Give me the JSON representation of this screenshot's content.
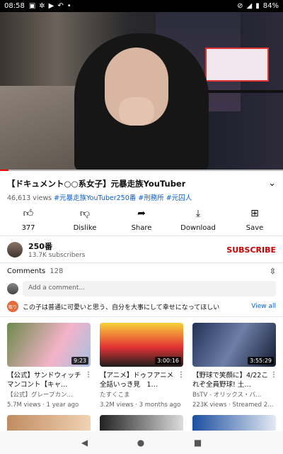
{
  "status_bar": {
    "time": "08:58",
    "battery": "84%"
  },
  "video": {
    "progress_fraction": 0.03
  },
  "title": "【ドキュメント○○系女子】元暴走族YouTuber",
  "meta": {
    "views": "46,613 views",
    "tags": [
      "#元暴走族YouTuber250番",
      "#刑務所",
      "#元囚人"
    ]
  },
  "actions": [
    {
      "icon": "thumbs-up-icon",
      "label": "377"
    },
    {
      "icon": "thumbs-down-icon",
      "label": "Dislike"
    },
    {
      "icon": "share-icon",
      "label": "Share"
    },
    {
      "icon": "download-icon",
      "label": "Download"
    },
    {
      "icon": "save-icon",
      "label": "Save"
    }
  ],
  "channel": {
    "name": "250番",
    "subscribers": "13.7K subscribers",
    "subscribe_label": "SUBSCRIBE"
  },
  "comments": {
    "header": "Comments",
    "count": "128",
    "placeholder": "Add a comment...",
    "top_avatar_text": "取り",
    "top_comment": "この子は普通に可愛いと思う、自分を大事にして幸せになってほしい",
    "view_all": "View all"
  },
  "recommendations": [
    {
      "title": "【公式】サンドウィッチマンコント【キャ…",
      "channel": "【公式】グレープカン…",
      "meta": "5.7M views · 1 year ago",
      "duration": "9:23"
    },
    {
      "title": "【アニメ】ドゥフアニメ全話いっき見　1…",
      "channel": "たすくこま",
      "meta": "3.2M views · 3 months ago",
      "duration": "3:00:16"
    },
    {
      "title": "【野球で笑顔に】4/22これぞ全員野球! 土…",
      "channel": "BsTV - オリックス・バ…",
      "meta": "223K views · Streamed 2…",
      "duration": "3:55:29"
    }
  ]
}
